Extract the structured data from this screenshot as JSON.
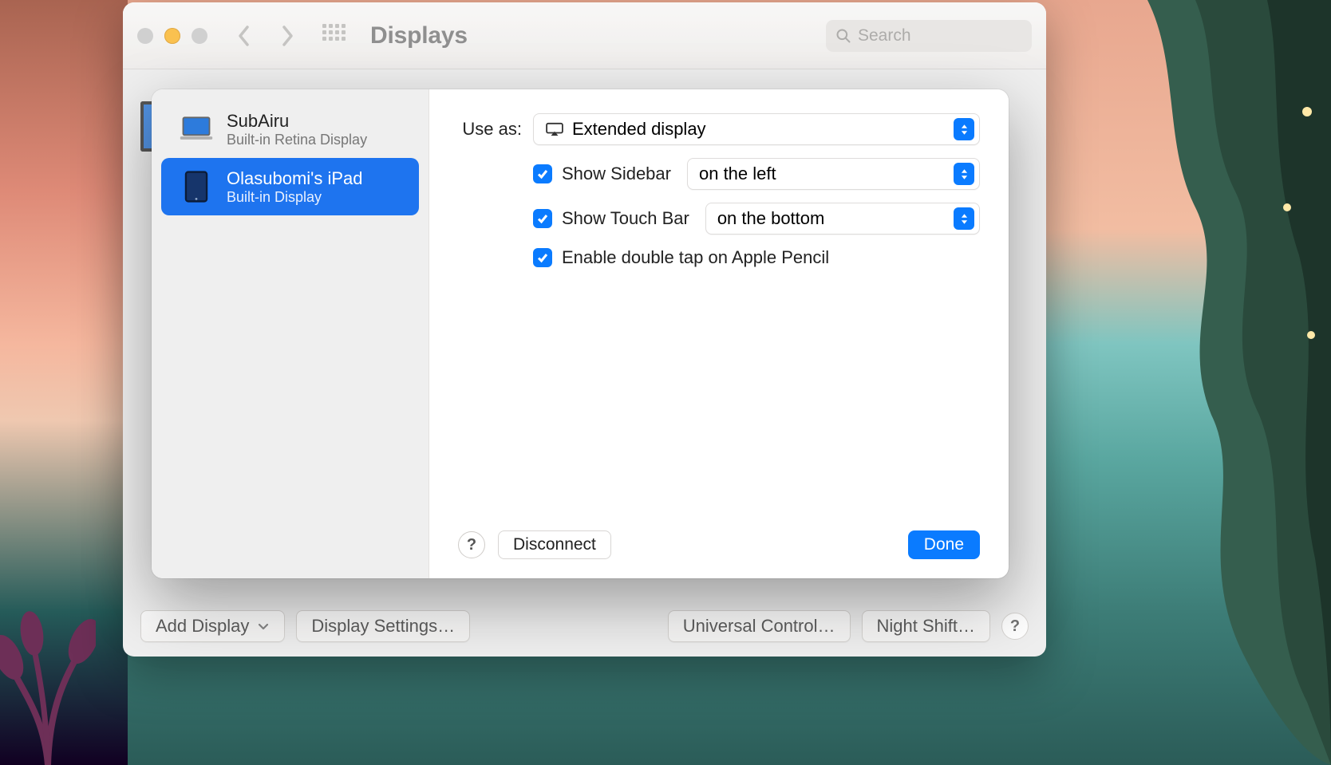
{
  "window": {
    "title": "Displays",
    "search_placeholder": "Search"
  },
  "bottom": {
    "add_display": "Add Display",
    "display_settings": "Display Settings…",
    "universal_control": "Universal Control…",
    "night_shift": "Night Shift…"
  },
  "sheet": {
    "devices": [
      {
        "name": "SubAiru",
        "subtitle": "Built-in Retina Display"
      },
      {
        "name": "Olasubomi's iPad",
        "subtitle": "Built-in Display"
      }
    ],
    "use_as_label": "Use as:",
    "use_as_value": "Extended display",
    "show_sidebar_label": "Show Sidebar",
    "show_sidebar_value": "on the left",
    "show_touchbar_label": "Show Touch Bar",
    "show_touchbar_value": "on the bottom",
    "enable_double_tap_label": "Enable double tap on Apple Pencil",
    "disconnect": "Disconnect",
    "done": "Done",
    "help": "?"
  }
}
